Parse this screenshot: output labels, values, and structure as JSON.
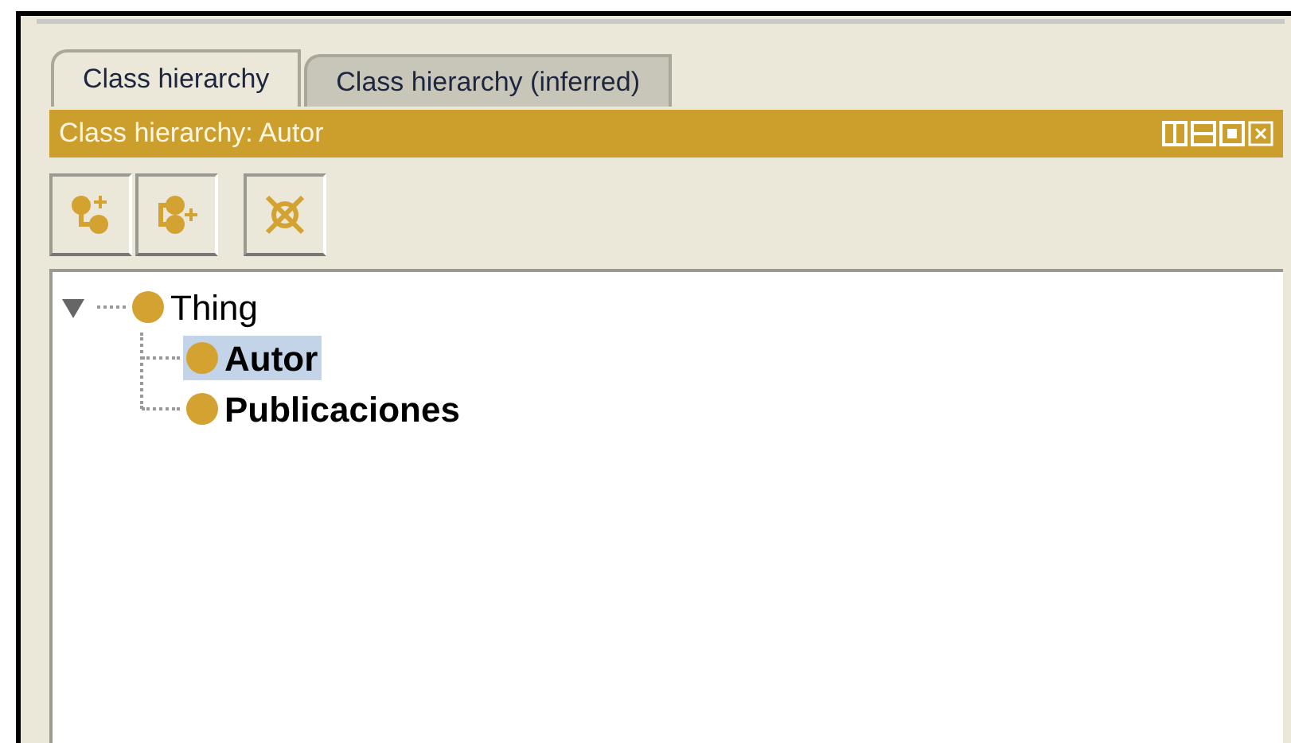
{
  "tabs": [
    {
      "label": "Class hierarchy",
      "selected": true
    },
    {
      "label": "Class hierarchy (inferred)",
      "selected": false
    }
  ],
  "panel": {
    "title": "Class hierarchy: Autor"
  },
  "tree": [
    {
      "label": "Thing",
      "bold": false,
      "selected": false,
      "expanded": true,
      "children": [
        {
          "label": "Autor",
          "bold": true,
          "selected": true
        },
        {
          "label": "Publicaciones",
          "bold": true,
          "selected": false
        }
      ]
    }
  ]
}
